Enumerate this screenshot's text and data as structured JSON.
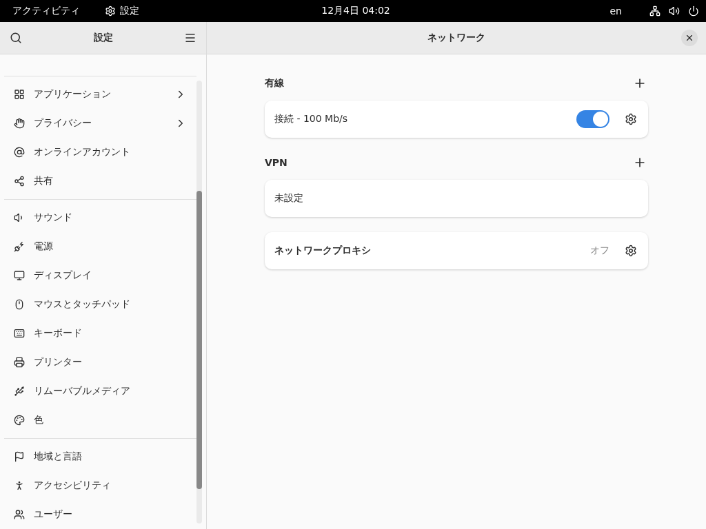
{
  "top_bar": {
    "activities": "アクティビティ",
    "app_name": "設定",
    "clock": "12月4日 04:02",
    "language": "en"
  },
  "sidebar": {
    "title": "設定",
    "groups": [
      {
        "items": [
          {
            "label": "アプリケーション",
            "submenu": true
          },
          {
            "label": "プライバシー",
            "submenu": true
          },
          {
            "label": "オンラインアカウント",
            "submenu": false
          },
          {
            "label": "共有",
            "submenu": false
          }
        ]
      },
      {
        "items": [
          {
            "label": "サウンド",
            "submenu": false
          },
          {
            "label": "電源",
            "submenu": false
          },
          {
            "label": "ディスプレイ",
            "submenu": false
          },
          {
            "label": "マウスとタッチパッド",
            "submenu": false
          },
          {
            "label": "キーボード",
            "submenu": false
          },
          {
            "label": "プリンター",
            "submenu": false
          },
          {
            "label": "リムーバブルメディア",
            "submenu": false
          },
          {
            "label": "色",
            "submenu": false
          }
        ]
      },
      {
        "items": [
          {
            "label": "地域と言語",
            "submenu": false
          },
          {
            "label": "アクセシビリティ",
            "submenu": false
          },
          {
            "label": "ユーザー",
            "submenu": false
          }
        ]
      }
    ]
  },
  "main": {
    "title": "ネットワーク",
    "sections": [
      {
        "heading": "有線",
        "rows": [
          {
            "kind": "toggle",
            "label": "接続 - 100 Mb/s",
            "on": true
          }
        ]
      },
      {
        "heading": "VPN",
        "rows": [
          {
            "kind": "plain",
            "label": "未設定"
          }
        ]
      },
      {
        "rows": [
          {
            "kind": "status",
            "label": "ネットワークプロキシ",
            "status": "オフ"
          }
        ]
      }
    ]
  }
}
